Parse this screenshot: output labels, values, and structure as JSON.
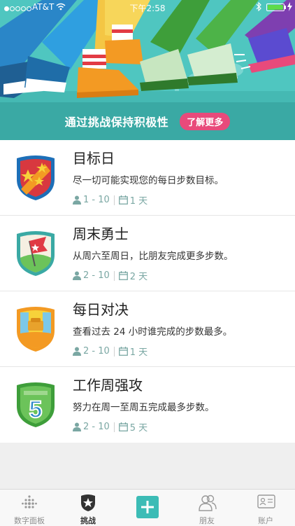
{
  "status_bar": {
    "carrier": "AT&T",
    "time": "下午2:58"
  },
  "banner": {
    "text": "通过挑战保持积极性",
    "learn_more": "了解更多"
  },
  "challenges": [
    {
      "title": "目标日",
      "description": "尽一切可能实现您的每日步数目标。",
      "players": "1 - 10",
      "duration": "1 天"
    },
    {
      "title": "周末勇士",
      "description": "从周六至周日，比朋友完成更多步数。",
      "players": "2 - 10",
      "duration": "2 天"
    },
    {
      "title": "每日对决",
      "description": "查看过去 24 小时谁完成的步数最多。",
      "players": "2 - 10",
      "duration": "1 天"
    },
    {
      "title": "工作周强攻",
      "description": "努力在周一至周五完成最多步数。",
      "players": "2 - 10",
      "duration": "5 天"
    }
  ],
  "tabs": {
    "dashboard": "数字面板",
    "challenges": "挑战",
    "friends": "朋友",
    "account": "账户"
  },
  "colors": {
    "teal": "#4fc6c0",
    "teal_dark": "#3aa9a4",
    "pink": "#e84a7b"
  }
}
